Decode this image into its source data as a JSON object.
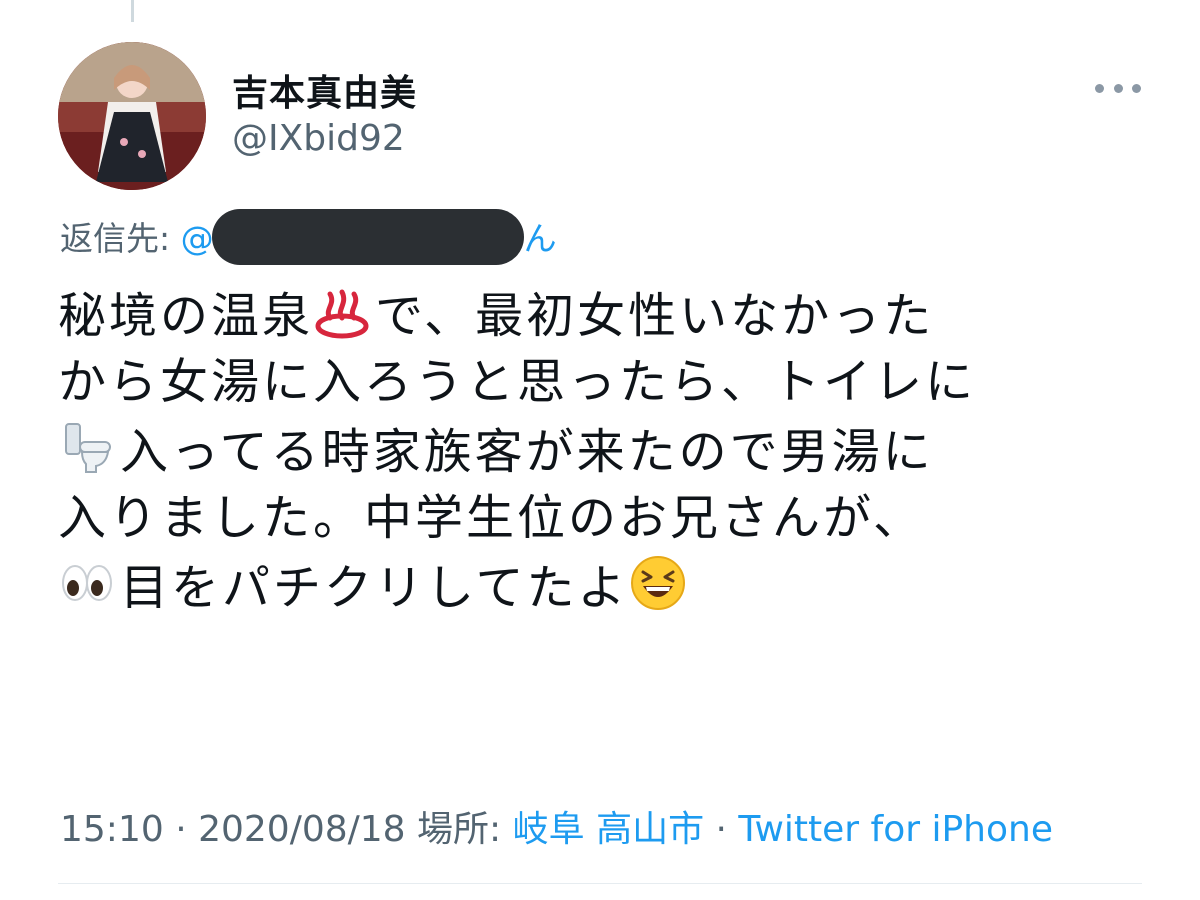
{
  "tweet": {
    "display_name": "吉本真由美",
    "handle": "@IXbid92",
    "reply_prefix": "返信先: ",
    "reply_mention_start": "@",
    "reply_mention_end": "ん",
    "body_lines": [
      {
        "before": "秘境の温泉",
        "emoji": "hotsprings-icon",
        "after": "で、最初女性いなかった"
      },
      {
        "before": "",
        "emoji": "",
        "after": "から女湯に入ろうと思ったら、トイレに"
      },
      {
        "before": "",
        "emoji": "toilet-icon",
        "after": "入ってる時家族客が来たので男湯に"
      },
      {
        "before": "",
        "emoji": "",
        "after": "入りました。中学生位のお兄さんが、"
      },
      {
        "before": "",
        "emoji": "eyes-icon",
        "after": "目をパチクリしてたよ"
      }
    ],
    "ending_emoji": "grinning-squinting-face-icon",
    "time": "15:10",
    "separator": " · ",
    "date": "2020/08/18",
    "location_label": " 場所: ",
    "location": "岐阜 高山市",
    "source": "Twitter for iPhone"
  },
  "colors": {
    "text": "#0f1419",
    "secondary": "#536471",
    "link": "#1d9bf0",
    "redaction": "#2b2f33"
  }
}
